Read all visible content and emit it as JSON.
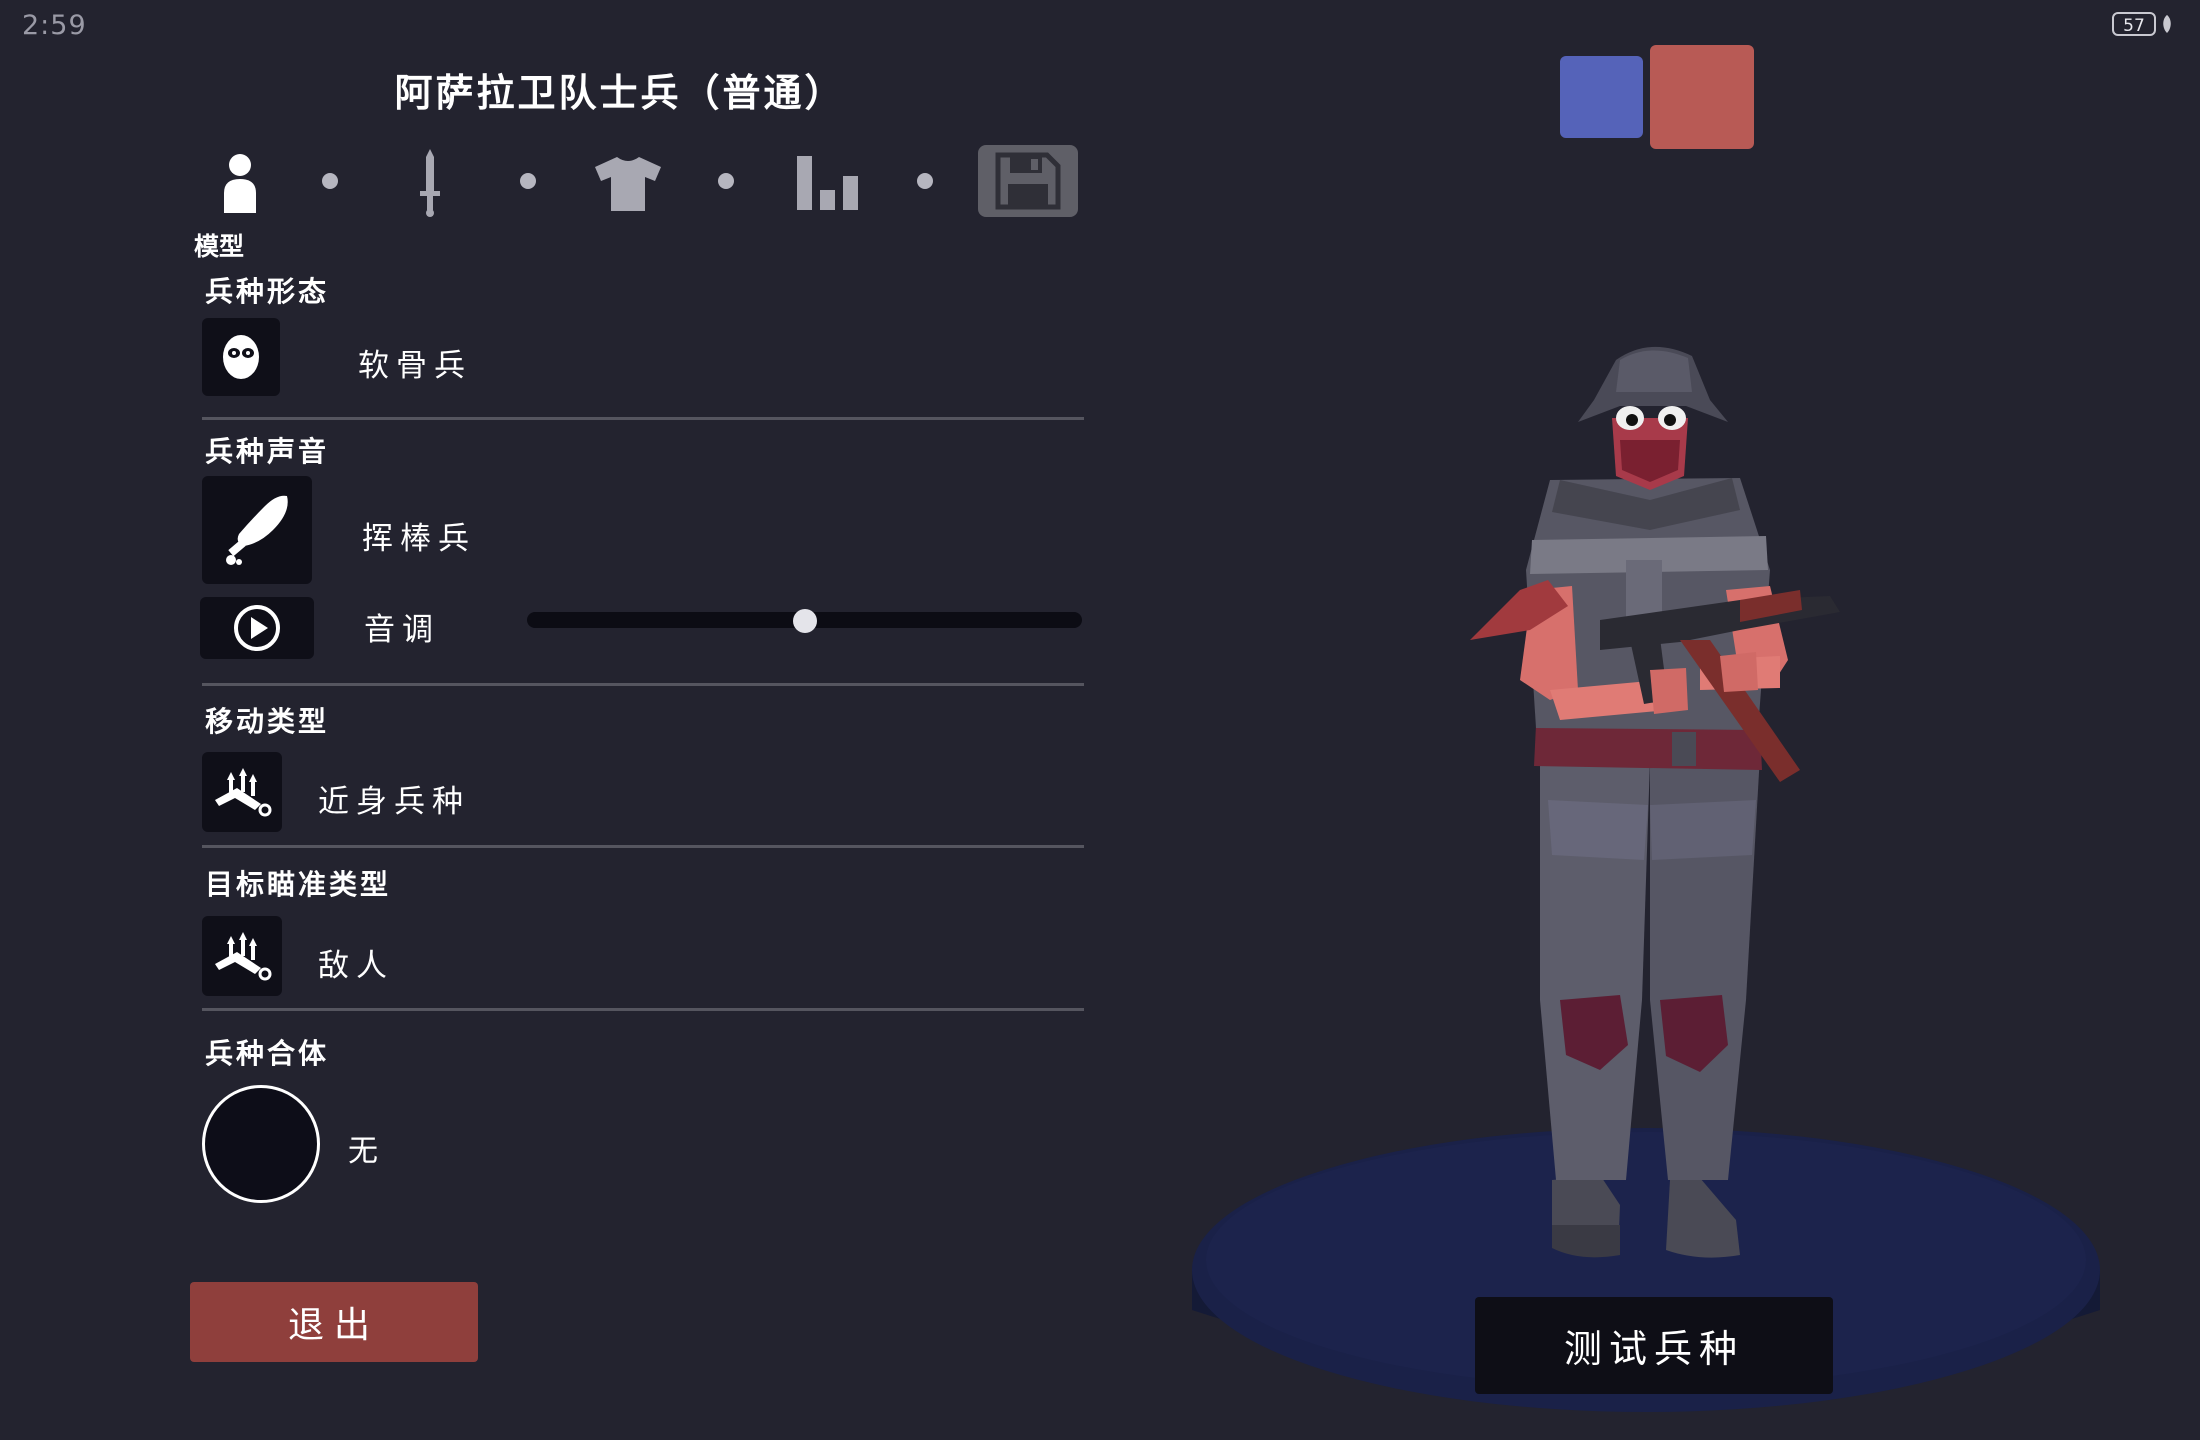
{
  "status_bar": {
    "time": "2:59",
    "battery": "57"
  },
  "title": "阿萨拉卫队士兵（普通）",
  "steps": [
    {
      "icon": "person-icon",
      "label": "模型",
      "active": true
    },
    {
      "icon": "sword-icon",
      "label": ""
    },
    {
      "icon": "shirt-icon",
      "label": ""
    },
    {
      "icon": "stats-icon",
      "label": ""
    },
    {
      "icon": "save-icon",
      "label": ""
    }
  ],
  "sections": {
    "form": {
      "label": "兵种形态",
      "value": "软骨兵",
      "icon": "skull-face-icon"
    },
    "voice": {
      "label": "兵种声音",
      "value": "挥棒兵",
      "icon": "club-icon"
    },
    "pitch": {
      "label": "音调",
      "icon": "play-icon",
      "value": 0.5
    },
    "movement": {
      "label": "移动类型",
      "value": "近身兵种",
      "icon": "melee-figures-icon"
    },
    "targeting": {
      "label": "目标瞄准类型",
      "value": "敌人",
      "icon": "melee-figures-icon"
    },
    "merge": {
      "label": "兵种合体",
      "value": "无"
    }
  },
  "buttons": {
    "exit": "退出",
    "test": "测试兵种"
  },
  "teams": {
    "blue": "#5563b9",
    "red": "#b85a55",
    "selected": "red"
  },
  "colors": {
    "background": "#23232f",
    "exit_button": "#8f3f3c",
    "panel": "#0f0f18"
  }
}
